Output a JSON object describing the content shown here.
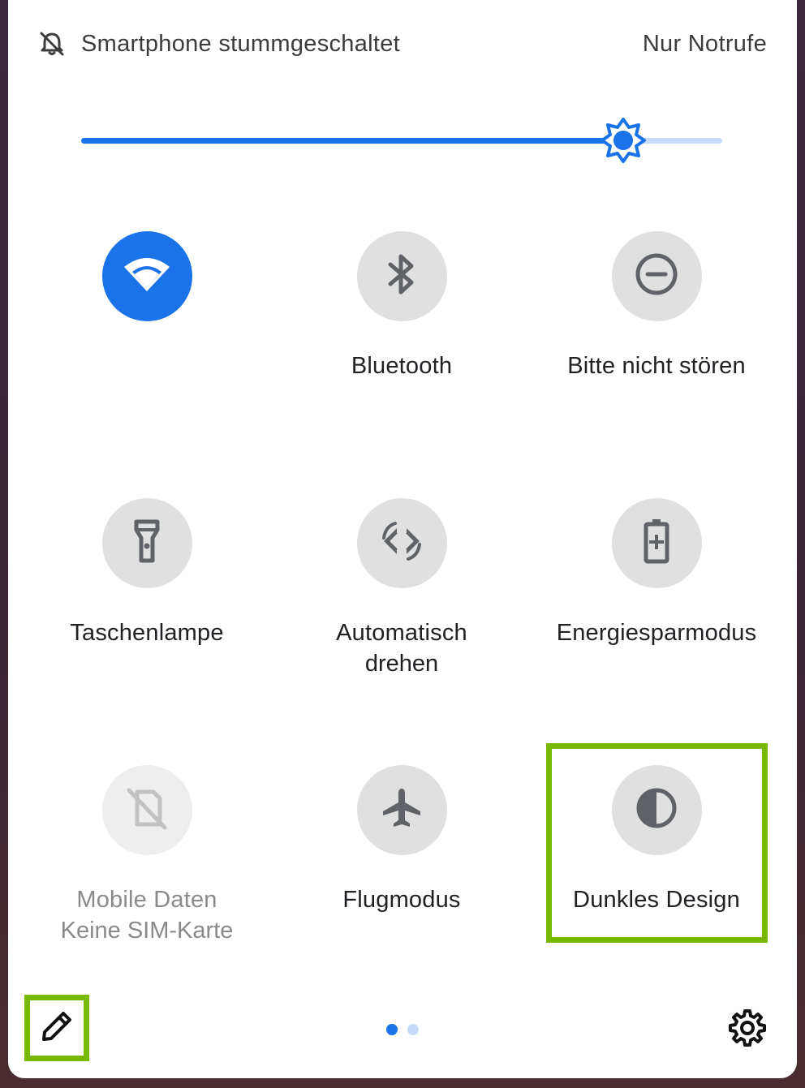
{
  "status_bar": {
    "mute_icon": "bell-off-icon",
    "mute_label": "Smartphone stummgeschaltet",
    "network_label": "Nur Notrufe"
  },
  "brightness": {
    "icon": "brightness-icon",
    "level_percent": 84.5
  },
  "tiles": [
    {
      "id": "wifi",
      "icon": "wifi-icon",
      "label": "",
      "state": "active"
    },
    {
      "id": "bluetooth",
      "icon": "bluetooth-icon",
      "label": "Bluetooth",
      "state": "inactive"
    },
    {
      "id": "dnd",
      "icon": "do-not-disturb-icon",
      "label": "Bitte nicht stören",
      "state": "inactive"
    },
    {
      "id": "flashlight",
      "icon": "flashlight-icon",
      "label": "Taschenlampe",
      "state": "inactive"
    },
    {
      "id": "autorotate",
      "icon": "rotate-icon",
      "label": "Automatisch",
      "sublabel": "drehen",
      "state": "inactive"
    },
    {
      "id": "battery_saver",
      "icon": "battery-saver-icon",
      "label": "Energiesparmodus",
      "state": "inactive"
    },
    {
      "id": "mobile_data",
      "icon": "no-sim-icon",
      "label": "Mobile Daten",
      "sublabel": "Keine SIM-Karte",
      "state": "disabled"
    },
    {
      "id": "airplane",
      "icon": "airplane-icon",
      "label": "Flugmodus",
      "state": "inactive"
    },
    {
      "id": "dark_theme",
      "icon": "dark-theme-icon",
      "label": "Dunkles Design",
      "state": "inactive"
    }
  ],
  "footer": {
    "edit_icon": "pencil-icon",
    "settings_icon": "gear-icon",
    "page_count": 2,
    "current_page": 1
  },
  "colors": {
    "accent": "#1a73e8",
    "accent_light": "#c6dafc",
    "highlight": "#76b900",
    "tile_inactive": "#e0e0e0",
    "icon_inactive": "#5f6368"
  }
}
